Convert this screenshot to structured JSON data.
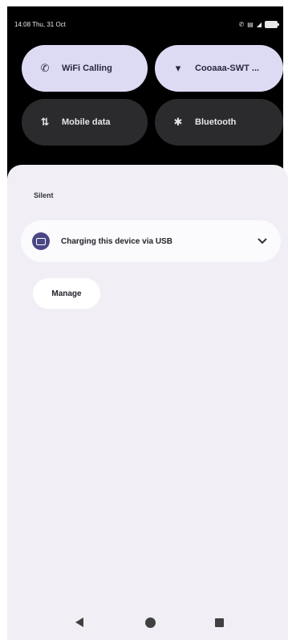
{
  "status_bar": {
    "time_date": "14:08 Thu, 31 Oct",
    "icons": [
      "vowifi-icon",
      "nfc-icon",
      "signal-icon",
      "battery-icon"
    ]
  },
  "quick_settings": {
    "tiles": [
      {
        "label": "WiFi Calling",
        "icon": "wifi-calling-icon",
        "state": "on"
      },
      {
        "label": "Cooaaa-SWT ...",
        "icon": "wifi-icon",
        "state": "on"
      },
      {
        "label": "Mobile data",
        "icon": "mobile-data-icon",
        "state": "off"
      },
      {
        "label": "Bluetooth",
        "icon": "bluetooth-icon",
        "state": "off"
      }
    ]
  },
  "notifications": {
    "section_label": "Silent",
    "items": [
      {
        "text": "Charging this device via USB",
        "icon": "usb-icon"
      }
    ],
    "manage_label": "Manage"
  },
  "nav": {
    "icons": [
      "back-icon",
      "home-icon",
      "recents-icon"
    ]
  },
  "colors": {
    "tile_on": "#dddbf4",
    "tile_off": "#2b2b2e",
    "shade_bg": "#f1eff5",
    "accent": "#4a4785"
  }
}
